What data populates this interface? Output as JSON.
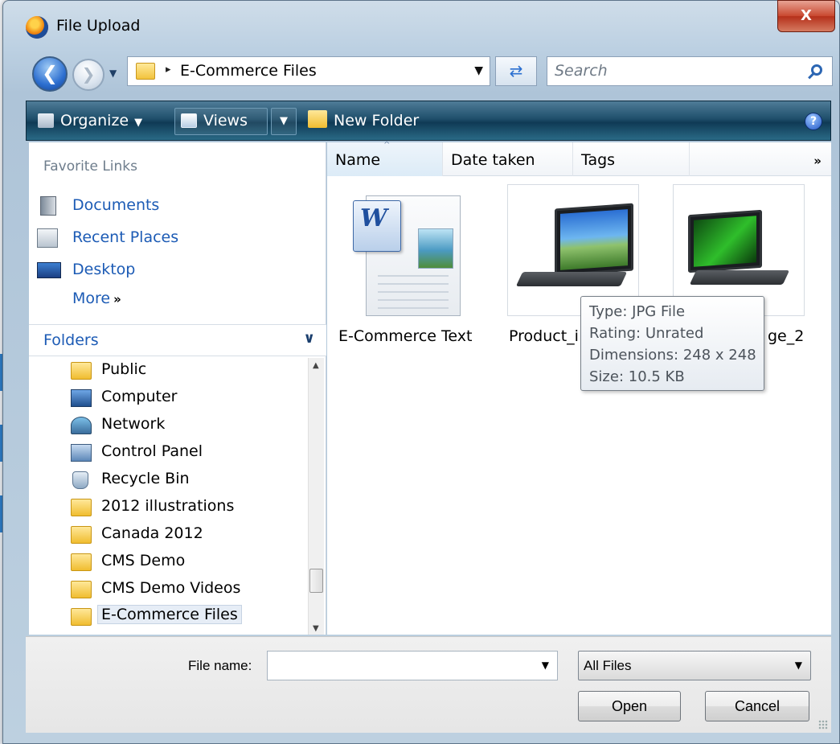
{
  "window": {
    "title": "File Upload",
    "close_glyph": "X"
  },
  "address": {
    "path_separator": "▸",
    "current_folder": "E-Commerce Files"
  },
  "search": {
    "placeholder": "Search"
  },
  "toolbar": {
    "organize": "Organize",
    "views": "Views",
    "new_folder": "New Folder",
    "help": "?"
  },
  "nav": {
    "favorites_header": "Favorite Links",
    "favorites": [
      {
        "label": "Documents",
        "icon": "documents-icon"
      },
      {
        "label": "Recent Places",
        "icon": "recent-places-icon"
      },
      {
        "label": "Desktop",
        "icon": "desktop-icon"
      }
    ],
    "more": "More",
    "more_glyph": "»",
    "folders_header": "Folders",
    "folders": [
      {
        "label": "Public",
        "icon": "folder-icon"
      },
      {
        "label": "Computer",
        "icon": "computer-icon"
      },
      {
        "label": "Network",
        "icon": "network-icon"
      },
      {
        "label": "Control Panel",
        "icon": "control-panel-icon"
      },
      {
        "label": "Recycle Bin",
        "icon": "recycle-bin-icon"
      },
      {
        "label": "2012 illustrations",
        "icon": "folder-icon"
      },
      {
        "label": "Canada 2012",
        "icon": "folder-icon"
      },
      {
        "label": "CMS Demo",
        "icon": "folder-icon"
      },
      {
        "label": "CMS Demo Videos",
        "icon": "folder-icon"
      },
      {
        "label": "E-Commerce Files",
        "icon": "folder-icon",
        "selected": true
      }
    ]
  },
  "columns": [
    {
      "label": "Name",
      "sorted": true
    },
    {
      "label": "Date taken"
    },
    {
      "label": "Tags"
    }
  ],
  "columns_more": "»",
  "files": [
    {
      "name": "E-Commerce Text",
      "icon": "word-document-icon"
    },
    {
      "name": "Product_i",
      "icon": "laptop-image-thumbnail"
    },
    {
      "name": "ge_2",
      "icon": "green-laptop-image-thumbnail"
    }
  ],
  "tooltip": {
    "type": "Type: JPG File",
    "rating": "Rating: Unrated",
    "dimensions": "Dimensions: 248 x 248",
    "size": "Size: 10.5 KB"
  },
  "bottom": {
    "file_name_label": "File name:",
    "file_name_value": "",
    "file_type": "All Files",
    "open": "Open",
    "cancel": "Cancel"
  }
}
